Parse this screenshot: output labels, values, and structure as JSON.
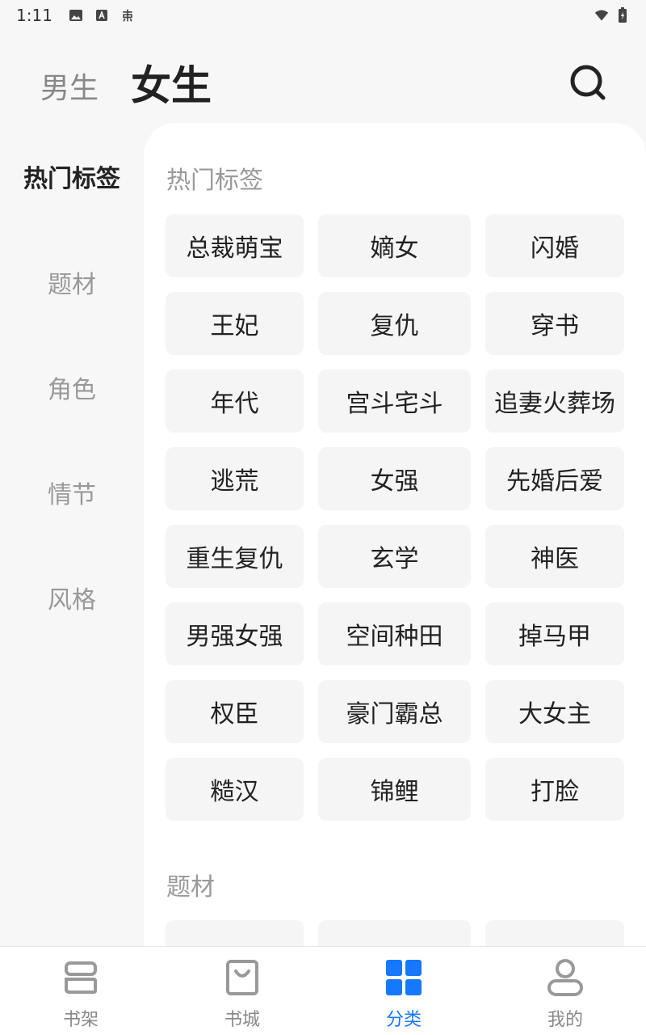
{
  "status_bar": {
    "time": "1:11"
  },
  "header": {
    "tab_male": "男生",
    "tab_female": "女生",
    "active_tab": "女生"
  },
  "side_nav": {
    "items": [
      "热门标签",
      "题材",
      "角色",
      "情节",
      "风格"
    ],
    "active": "热门标签"
  },
  "sections": {
    "hot_tags": {
      "title": "热门标签",
      "tags": [
        "总裁萌宝",
        "嫡女",
        "闪婚",
        "王妃",
        "复仇",
        "穿书",
        "年代",
        "宫斗宅斗",
        "追妻火葬场",
        "逃荒",
        "女强",
        "先婚后爱",
        "重生复仇",
        "玄学",
        "神医",
        "男强女强",
        "空间种田",
        "掉马甲",
        "权臣",
        "豪门霸总",
        "大女主",
        "糙汉",
        "锦鲤",
        "打脸"
      ]
    },
    "theme": {
      "title": "题材"
    }
  },
  "bottom_nav": {
    "items": [
      {
        "label": "书架",
        "icon": "bookshelf-icon"
      },
      {
        "label": "书城",
        "icon": "bookstore-bag-icon"
      },
      {
        "label": "分类",
        "icon": "category-grid-icon"
      },
      {
        "label": "我的",
        "icon": "profile-icon"
      }
    ],
    "active": "分类"
  },
  "colors": {
    "accent": "#1677ff",
    "inactive": "#888888",
    "tag_bg": "#f5f5f5"
  }
}
